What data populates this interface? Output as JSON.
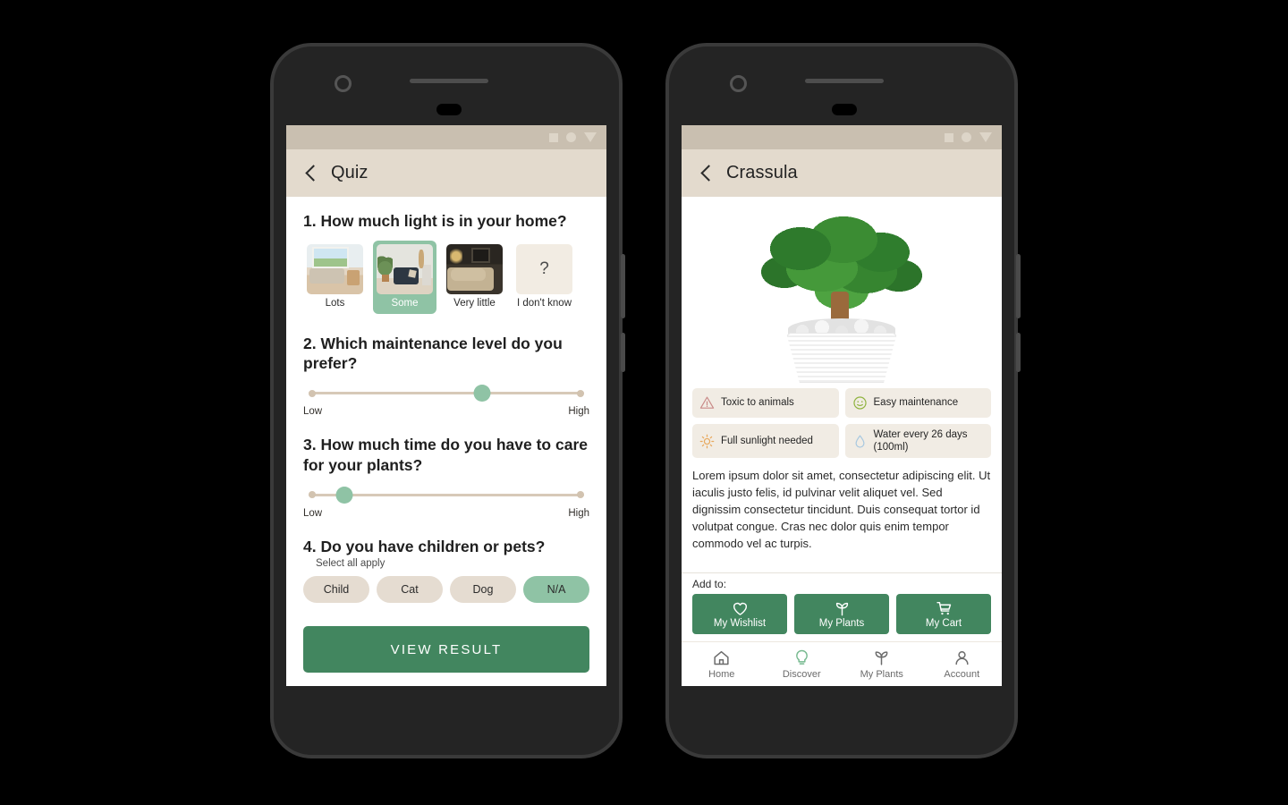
{
  "colors": {
    "accent_green": "#42865f",
    "light_green": "#8fc3a5",
    "beige_bar": "#e3dacd",
    "status_bar": "#c9bfb0",
    "chip_beige": "#e5dcd1",
    "info_chip": "#f1ece4",
    "warning_red": "#c98a88",
    "sun_orange": "#e8a85c",
    "smiley_green": "#8fb33f",
    "water_blue": "#a8c8e0"
  },
  "status_bar": {
    "icons": [
      "square-icon",
      "circle-icon",
      "triangle-down-icon"
    ]
  },
  "quiz_screen": {
    "app_bar": {
      "back_icon": "back-chevron-icon",
      "title": "Quiz"
    },
    "questions": [
      {
        "number": "1.",
        "title": "1. How much light is in your home?",
        "type": "image-choice",
        "options": [
          {
            "label": "Lots",
            "selected": false,
            "art": "bright-room"
          },
          {
            "label": "Some",
            "selected": true,
            "art": "medium-room"
          },
          {
            "label": "Very little",
            "selected": false,
            "art": "dark-room"
          },
          {
            "label": "I don't know",
            "selected": false,
            "art": "question-mark"
          }
        ]
      },
      {
        "number": "2.",
        "title": "2. Which maintenance level do you prefer?",
        "type": "slider",
        "min_label": "Low",
        "max_label": "High",
        "value_percent": 63
      },
      {
        "number": "3.",
        "title": "3. How much time do you have to  care for your plants?",
        "type": "slider",
        "min_label": "Low",
        "max_label": "High",
        "value_percent": 13
      },
      {
        "number": "4.",
        "title": "4. Do you have children or pets?",
        "subtitle": "Select all apply",
        "type": "chips",
        "options": [
          {
            "label": "Child",
            "selected": false
          },
          {
            "label": "Cat",
            "selected": false
          },
          {
            "label": "Dog",
            "selected": false
          },
          {
            "label": "N/A",
            "selected": true
          }
        ]
      }
    ],
    "submit_button": "VIEW RESULT"
  },
  "detail_screen": {
    "app_bar": {
      "back_icon": "back-chevron-icon",
      "title": "Crassula"
    },
    "hero_image_alt": "crassula-jade-plant-in-white-pot",
    "info_chips": [
      {
        "icon": "warning-triangle-icon",
        "text": "Toxic to animals"
      },
      {
        "icon": "smiley-face-icon",
        "text": "Easy maintenance"
      },
      {
        "icon": "sun-icon",
        "text": "Full sunlight needed"
      },
      {
        "icon": "water-drop-icon",
        "text": "Water every 26 days (100ml)"
      }
    ],
    "description": "Lorem ipsum dolor sit amet, consectetur adipiscing elit. Ut iaculis justo felis, id pulvinar velit aliquet vel. Sed dignissim consectetur tincidunt. Duis consequat tortor id volutpat congue. Cras nec dolor quis enim tempor commodo vel ac turpis.",
    "add_to": {
      "label": "Add to:",
      "buttons": [
        {
          "icon": "heart-icon",
          "label": "My Wishlist"
        },
        {
          "icon": "sprout-icon",
          "label": "My Plants"
        },
        {
          "icon": "cart-icon",
          "label": "My Cart"
        }
      ]
    },
    "tab_bar": [
      {
        "icon": "home-icon",
        "label": "Home",
        "active": false
      },
      {
        "icon": "lightbulb-icon",
        "label": "Discover",
        "active": true
      },
      {
        "icon": "sprout-icon",
        "label": "My Plants",
        "active": false
      },
      {
        "icon": "person-icon",
        "label": "Account",
        "active": false
      }
    ]
  }
}
